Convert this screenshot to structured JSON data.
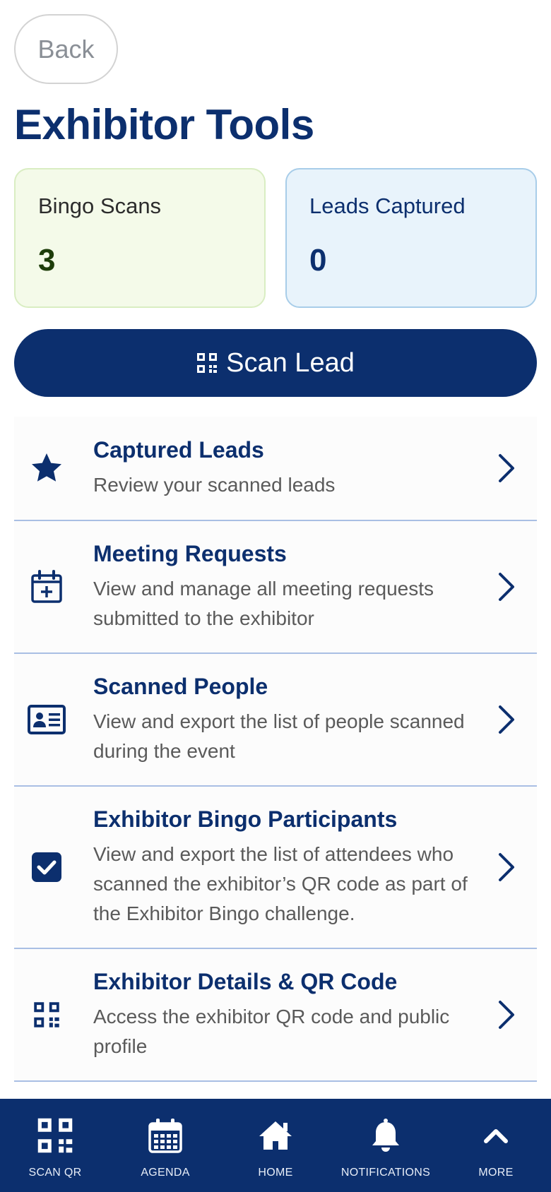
{
  "header": {
    "back_label": "Back",
    "title": "Exhibitor Tools"
  },
  "stats": {
    "bingo": {
      "label": "Bingo Scans",
      "value": "3"
    },
    "leads": {
      "label": "Leads Captured",
      "value": "0"
    }
  },
  "scan_button": {
    "label": "Scan Lead",
    "icon": "qr-code-icon"
  },
  "tools": [
    {
      "title": "Captured Leads",
      "desc": "Review your scanned leads",
      "icon": "star-icon"
    },
    {
      "title": "Meeting Requests",
      "desc": "View and manage all meeting requests submitted to the exhibitor",
      "icon": "calendar-plus-icon"
    },
    {
      "title": "Scanned People",
      "desc": "View and export the list of people scanned during the event",
      "icon": "id-card-icon"
    },
    {
      "title": "Exhibitor Bingo Participants",
      "desc": "View and export the list of attendees who scanned the exhibitor’s QR code as part of the Exhibitor Bingo challenge.",
      "icon": "checkbox-icon"
    },
    {
      "title": "Exhibitor Details & QR Code",
      "desc": "Access the exhibitor QR code and public profile",
      "icon": "qr-code-icon"
    }
  ],
  "nav": [
    {
      "label": "SCAN QR",
      "icon": "qr-code-icon"
    },
    {
      "label": "AGENDA",
      "icon": "calendar-icon"
    },
    {
      "label": "HOME",
      "icon": "home-icon"
    },
    {
      "label": "NOTIFICATIONS",
      "icon": "bell-icon"
    },
    {
      "label": "MORE",
      "icon": "chevron-up-icon"
    }
  ],
  "colors": {
    "primary": "#0c2f6e",
    "bingo_bg": "#f4fae9",
    "leads_bg": "#e8f3fb",
    "divider": "#a9bfe4"
  }
}
